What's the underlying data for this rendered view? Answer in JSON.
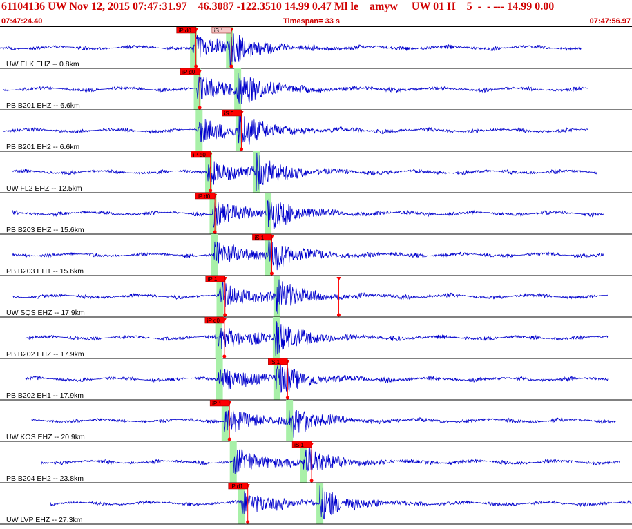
{
  "header": {
    "title": "61104136 UW Nov 12, 2015 07:47:31.97    46.3087 -122.3510 14.99 0.47 Ml le    amyw     UW 01 H    5  -  - --- 14.99 0.00",
    "start_time": "07:47:24.40",
    "timespan": "Timespan=  33 s",
    "end_time": "07:47:56.97"
  },
  "colors": {
    "trace": "#0000cc",
    "pick": "#ff0000",
    "window": "#a8f0a8",
    "text": "#d00000"
  },
  "traces": [
    {
      "label": "UW ELK EHZ -- 0.8km",
      "picks": [
        {
          "text": "iP d0",
          "t": 0.31,
          "style": "red"
        },
        {
          "text": "iS 1",
          "t": 0.366,
          "style": "pink"
        }
      ],
      "windows": [
        0.305,
        0.362
      ],
      "trace_span": [
        0.0,
        0.92
      ]
    },
    {
      "label": "PB B201 EHZ -- 6.6km",
      "picks": [
        {
          "text": "iP d0",
          "t": 0.316,
          "style": "red"
        }
      ],
      "windows": [
        0.311,
        0.375
      ],
      "trace_span": [
        0.005,
        0.93
      ]
    },
    {
      "label": "PB B201 EH2 -- 6.6km",
      "picks": [
        {
          "text": "iS 0",
          "t": 0.382,
          "style": "red"
        }
      ],
      "windows": [
        0.314,
        0.377
      ],
      "trace_span": [
        0.005,
        0.93
      ]
    },
    {
      "label": "UW FL2 EHZ -- 12.5km",
      "picks": [
        {
          "text": "iP d0",
          "t": 0.333,
          "style": "red"
        }
      ],
      "windows": [
        0.329,
        0.405
      ],
      "trace_span": [
        0.02,
        0.945
      ]
    },
    {
      "label": "PB B203 EHZ -- 15.6km",
      "picks": [
        {
          "text": "iP d0",
          "t": 0.34,
          "style": "red"
        }
      ],
      "windows": [
        0.336,
        0.423
      ],
      "trace_span": [
        0.02,
        0.955
      ]
    },
    {
      "label": "PB B203 EH1 -- 15.6km",
      "picks": [
        {
          "text": "iS 1",
          "t": 0.43,
          "style": "red"
        }
      ],
      "windows": [
        0.338,
        0.424
      ],
      "trace_span": [
        0.02,
        0.955
      ]
    },
    {
      "label": "UW SQS EHZ -- 17.9km",
      "picks": [
        {
          "text": "iP 1",
          "t": 0.356,
          "style": "red"
        },
        {
          "text": "",
          "t": 0.536,
          "style": "red"
        }
      ],
      "windows": [
        0.347,
        0.437
      ],
      "trace_span": [
        0.02,
        0.962
      ]
    },
    {
      "label": "PB B202 EHZ -- 17.9km",
      "picks": [
        {
          "text": "iP d0",
          "t": 0.355,
          "style": "red"
        }
      ],
      "windows": [
        0.345,
        0.436
      ],
      "trace_span": [
        0.04,
        0.962
      ]
    },
    {
      "label": "PB B202 EH1 -- 17.9km",
      "picks": [
        {
          "text": "iS 1",
          "t": 0.455,
          "style": "red"
        }
      ],
      "windows": [
        0.346,
        0.437
      ],
      "trace_span": [
        0.04,
        0.962
      ]
    },
    {
      "label": "UW KOS EHZ -- 20.9km",
      "picks": [
        {
          "text": "iP 1",
          "t": 0.363,
          "style": "red"
        }
      ],
      "windows": [
        0.355,
        0.457
      ],
      "trace_span": [
        0.05,
        0.975
      ]
    },
    {
      "label": "PB B204 EH2 -- 23.8km",
      "picks": [
        {
          "text": "iS 1",
          "t": 0.493,
          "style": "red"
        }
      ],
      "windows": [
        0.368,
        0.479
      ],
      "trace_span": [
        0.065,
        0.98
      ]
    },
    {
      "label": "UW LVP EHZ -- 27.3km",
      "picks": [
        {
          "text": "iP d1",
          "t": 0.392,
          "style": "red"
        }
      ],
      "windows": [
        0.381,
        0.505
      ],
      "trace_span": [
        0.08,
        1.0
      ]
    }
  ]
}
